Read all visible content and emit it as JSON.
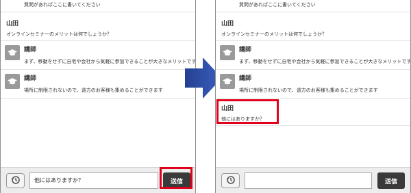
{
  "left_panel": {
    "top_partial_text": "質問があればここに書いてください",
    "messages": [
      {
        "name": "山田",
        "text": "オンラインセミナーのメリットは何でしょうか？"
      },
      {
        "name": "講師",
        "text": "まず、移動をせずに自宅や会社から気軽に参加できることが大きなメリットです"
      },
      {
        "name": "講師",
        "text": "場所に制限されないので、遠方のお客様も集めることができます"
      }
    ],
    "input_value": "他にはありますか？",
    "send_label": "送信"
  },
  "right_panel": {
    "top_partial_text": "質問があればここに書いてください",
    "messages": [
      {
        "name": "山田",
        "text": "オンラインセミナーのメリットは何でしょうか？"
      },
      {
        "name": "講師",
        "text": "まず、移動をせずに自宅や会社から気軽に参加できることが大きなメリットです"
      },
      {
        "name": "講師",
        "text": "場所に制限されないので、遠方のお客様も集めることができます"
      },
      {
        "name": "山田",
        "text": "他にはありますか？"
      }
    ],
    "input_value": "",
    "send_label": "送信"
  },
  "colors": {
    "highlight": "#e0001b",
    "arrow": "#2f4fa3",
    "send_button": "#3a3a3a",
    "avatar": "#9a9a9a"
  },
  "icons": {
    "lecturer_avatar": "graduation-cap-icon",
    "history_button": "history-icon",
    "transition_arrow": "arrow-right-icon"
  }
}
